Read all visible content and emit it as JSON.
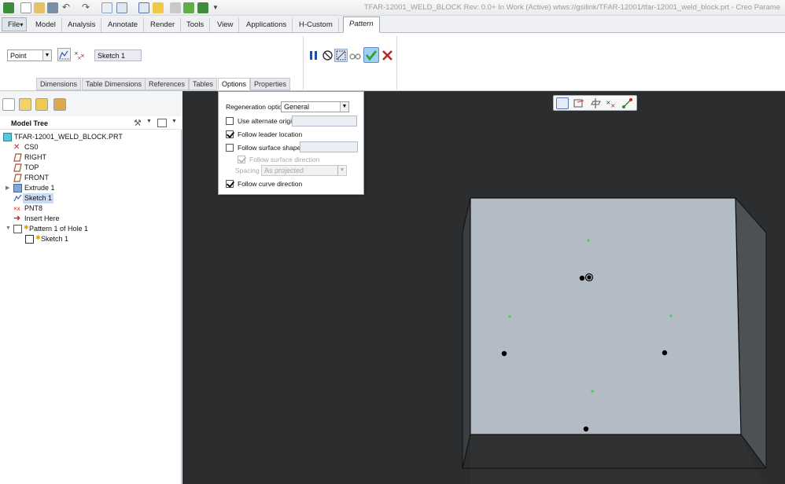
{
  "window": {
    "title": "TFAR-12001_WELD_BLOCK Rev: 0.0+ In Work  (Active) wtws://gsilink/TFAR-12001/tfar-12001_weld_block.prt - Creo Parame"
  },
  "tabs": [
    {
      "label": "File",
      "arrow": "▾"
    },
    {
      "label": "Model"
    },
    {
      "label": "Analysis"
    },
    {
      "label": "Annotate"
    },
    {
      "label": "Render"
    },
    {
      "label": "Tools"
    },
    {
      "label": "View"
    },
    {
      "label": "Applications"
    },
    {
      "label": "H-Custom"
    },
    {
      "label": "Pattern"
    }
  ],
  "ribbon": {
    "pattern_type": "Point",
    "sketch_field": "Sketch 1",
    "subtabs": [
      "Dimensions",
      "Table Dimensions",
      "References",
      "Tables",
      "Options",
      "Properties"
    ]
  },
  "model_tree": {
    "title": "Model Tree",
    "items": [
      {
        "label": "TFAR-12001_WELD_BLOCK.PRT"
      },
      {
        "label": "CS0"
      },
      {
        "label": "RIGHT"
      },
      {
        "label": "TOP"
      },
      {
        "label": "FRONT"
      },
      {
        "label": "Extrude 1"
      },
      {
        "label": "Sketch 1"
      },
      {
        "label": "PNT8"
      },
      {
        "label": "Insert Here"
      },
      {
        "label": "Pattern 1 of Hole 1"
      },
      {
        "label": "Sketch 1"
      }
    ]
  },
  "options": {
    "regeneration_label": "Regeneration option",
    "regeneration_value": "General",
    "use_alternate_origin": {
      "label": "Use alternate origin",
      "checked": false
    },
    "follow_leader_location": {
      "label": "Follow leader location",
      "checked": true
    },
    "follow_surface_shape": {
      "label": "Follow surface shape",
      "checked": false
    },
    "follow_surface_direction": {
      "label": "Follow surface direction",
      "checked": true,
      "disabled": true
    },
    "spacing_label": "Spacing",
    "spacing_value": "As projected",
    "follow_curve_direction": {
      "label": "Follow curve direction",
      "checked": true
    }
  },
  "colors": {
    "viewport_bg": "#2b2d2f",
    "model_top_face": "#b3bcc5",
    "model_side_face": "#4d5155",
    "model_bottom_face": "#2f3133",
    "ok_green": "#2ea43a",
    "cancel_red": "#c0202a"
  }
}
